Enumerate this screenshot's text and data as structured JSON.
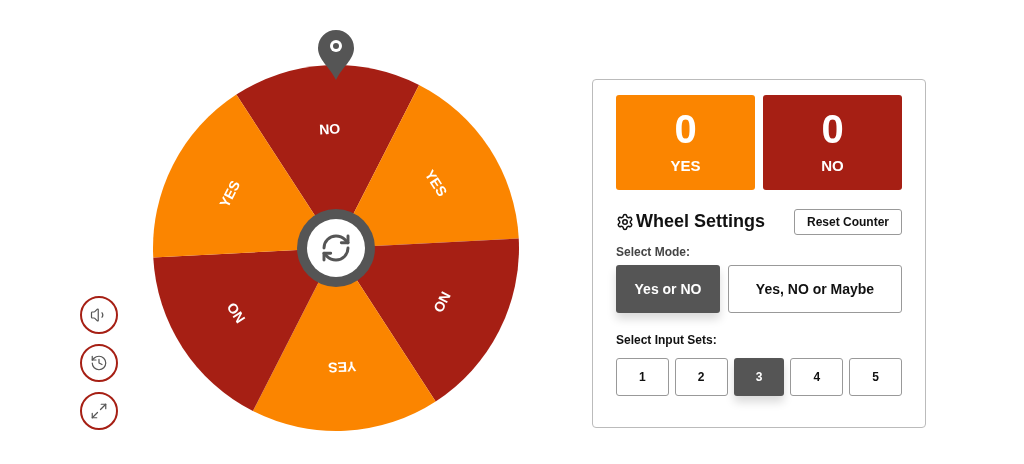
{
  "wheel": {
    "segments": [
      {
        "label": "NO",
        "color": "#a61f14"
      },
      {
        "label": "YES",
        "color": "#fb8500"
      },
      {
        "label": "NO",
        "color": "#a61f14"
      },
      {
        "label": "YES",
        "color": "#fb8500"
      },
      {
        "label": "NO",
        "color": "#a61f14"
      },
      {
        "label": "YES",
        "color": "#fb8500"
      }
    ]
  },
  "side_buttons": [
    {
      "kind": "sound"
    },
    {
      "kind": "history"
    },
    {
      "kind": "fullscreen"
    }
  ],
  "panel": {
    "counters": [
      {
        "value": "0",
        "label": "YES",
        "color": "#fb8500"
      },
      {
        "value": "0",
        "label": "NO",
        "color": "#a61f14"
      }
    ],
    "settings_title": "Wheel Settings",
    "reset_button": "Reset Counter",
    "mode_label": "Select Mode:",
    "modes": [
      {
        "label": "Yes or NO",
        "selected": true
      },
      {
        "label": "Yes, NO or Maybe",
        "selected": false
      }
    ],
    "input_sets_label": "Select Input Sets:",
    "input_sets": [
      {
        "label": "1",
        "selected": false
      },
      {
        "label": "2",
        "selected": false
      },
      {
        "label": "3",
        "selected": true
      },
      {
        "label": "4",
        "selected": false
      },
      {
        "label": "5",
        "selected": false
      }
    ]
  }
}
